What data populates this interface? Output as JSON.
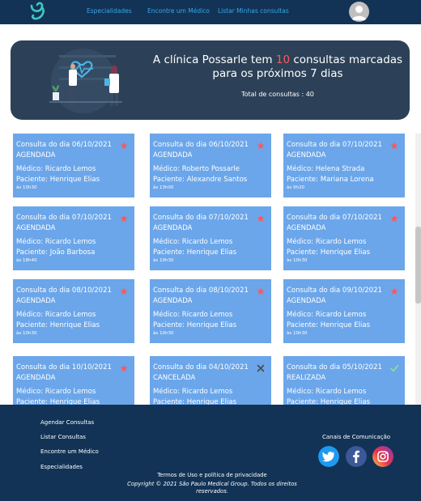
{
  "nav": {
    "links": [
      "Especialidades",
      "Encontre um Médico",
      "Listar Minhas consultas"
    ]
  },
  "banner": {
    "headline_pre": "A clínica Possarle tem ",
    "count": "10",
    "headline_post": " consultas marcadas para os próximos 7 dias",
    "total": "Total de consultas : 40"
  },
  "appointments": [
    {
      "title": "Consulta do dia 06/10/2021",
      "status": "AGENDADA",
      "doctor": "Médico: Ricardo Lemos",
      "patient": "Paciente: Henrique Elias",
      "time": "às 10h30",
      "mark": "star"
    },
    {
      "title": "Consulta do dia 06/10/2021",
      "status": "AGENDADA",
      "doctor": "Médico: Roberto Possarle",
      "patient": "Paciente: Alexandre Santos",
      "time": "às 13h00",
      "mark": "star"
    },
    {
      "title": "Consulta do dia 07/10/2021",
      "status": "AGENDADA",
      "doctor": "Médico: Helena Strada",
      "patient": "Paciente: Mariana Lorena",
      "time": "às 9h20",
      "mark": "star"
    },
    {
      "title": "Consulta do dia 07/10/2021",
      "status": "AGENDADA",
      "doctor": "Médico: Ricardo Lemos",
      "patient": "Paciente: João Barbosa",
      "time": "às 18h40",
      "mark": "star"
    },
    {
      "title": "Consulta do dia 07/10/2021",
      "status": "AGENDADA",
      "doctor": "Médico: Ricardo Lemos",
      "patient": "Paciente: Henrique Elias",
      "time": "às 10h30",
      "mark": "star"
    },
    {
      "title": "Consulta do dia 07/10/2021",
      "status": "AGENDADA",
      "doctor": "Médico: Ricardo Lemos",
      "patient": "Paciente: Henrique Elias",
      "time": "às 10h30",
      "mark": "star"
    },
    {
      "title": "Consulta do dia 08/10/2021",
      "status": "AGENDADA",
      "doctor": "Médico: Ricardo Lemos",
      "patient": "Paciente: Henrique Elias",
      "time": "às 10h30",
      "mark": "star"
    },
    {
      "title": "Consulta do dia 08/10/2021",
      "status": "AGENDADA",
      "doctor": "Médico: Ricardo Lemos",
      "patient": "Paciente: Henrique Elias",
      "time": "às 10h30",
      "mark": "star"
    },
    {
      "title": "Consulta do dia 09/10/2021",
      "status": "AGENDADA",
      "doctor": "Médico: Ricardo Lemos",
      "patient": "Paciente: Henrique Elias",
      "time": "às 10h30",
      "mark": "star"
    },
    {
      "title": "Consulta do dia 10/10/2021",
      "status": "AGENDADA",
      "doctor": "Médico: Ricardo Lemos",
      "patient": "Paciente: Henrique Elias",
      "time": "",
      "mark": "star"
    },
    {
      "title": "Consulta do dia 04/10/2021",
      "status": "CANCELADA",
      "doctor": "Médico: Ricardo Lemos",
      "patient": "Paciente: Henrique Elias",
      "time": "",
      "mark": "x"
    },
    {
      "title": "Consulta do dia 05/10/2021",
      "status": "REALIZADA",
      "doctor": "Médico: Ricardo Lemos",
      "patient": "Paciente: Henrique Elias",
      "time": "",
      "mark": "check"
    }
  ],
  "footer": {
    "links": [
      "Agendar Consultas",
      "Listar Consultas",
      "Encontre um Médico",
      "Especialidades"
    ],
    "canais": "Canais de Comunicação",
    "terms": "Termos de Uso e política de privacidade",
    "copyright": "Copyright © 2021 São Paulo Medical Group. Todos os direitos reservados."
  },
  "colors": {
    "navy": "#123356",
    "banner": "#2c4157",
    "card": "#6ba6ea",
    "accent": "#ff5757",
    "nav_link": "#38a6e8"
  },
  "icons": [
    "logo-icon",
    "user-avatar-icon",
    "star-icon",
    "close-icon",
    "check-icon",
    "twitter-icon",
    "facebook-icon",
    "instagram-icon"
  ]
}
